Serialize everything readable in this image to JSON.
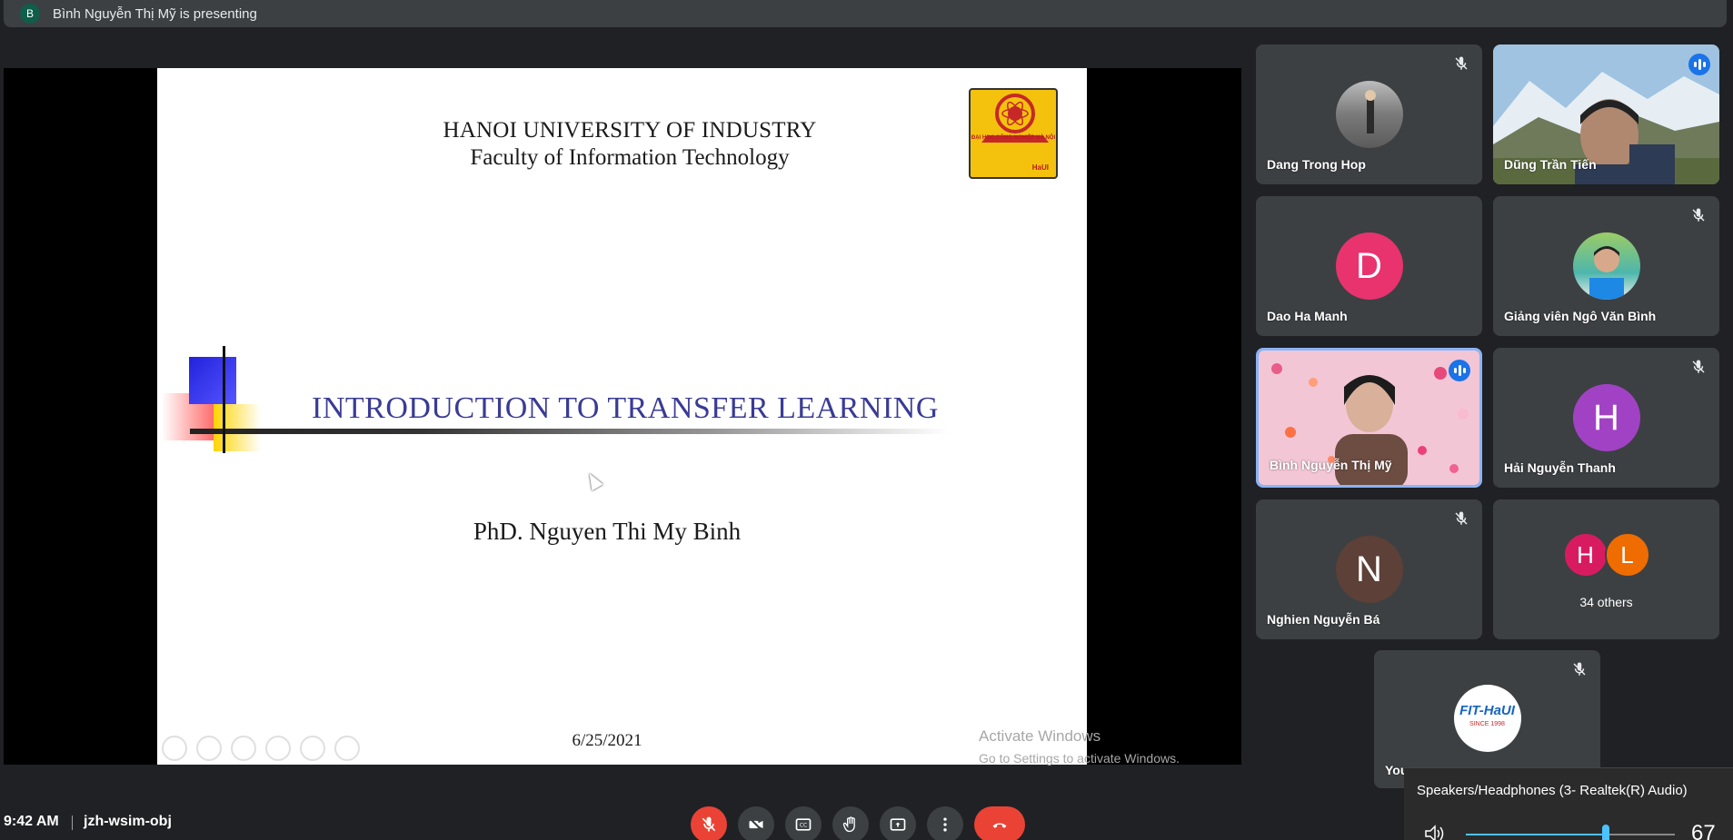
{
  "presenting": {
    "initial": "B",
    "text": "Bình Nguyễn Thị Mỹ is presenting"
  },
  "slide": {
    "university": "HANOI UNIVERSITY OF INDUSTRY",
    "faculty": "Faculty of Information Technology",
    "logo_text": "ĐẠI HỌC CÔNG NGHIỆP HÀ NỘI",
    "logo_brand": "HaUI",
    "title": "INTRODUCTION TO TRANSFER LEARNING",
    "author": "PhD. Nguyen Thi My Binh",
    "date": "6/25/2021"
  },
  "watermark": {
    "line1": "Activate Windows",
    "line2": "Go to Settings to activate Windows."
  },
  "participants": [
    {
      "name": "Dang Trong Hop",
      "muted": true
    },
    {
      "name": "Dũng Trần Tiến",
      "speaking": true
    },
    {
      "name": "Dao Ha Manh",
      "initial": "D",
      "color": "#e8336e",
      "muted": true
    },
    {
      "name": "Giảng viên Ngô Văn Bình",
      "muted": true
    },
    {
      "name": "Bình Nguyễn Thị Mỹ",
      "speaking": true
    },
    {
      "name": "Hải Nguyễn Thanh",
      "initial": "H",
      "color": "#a142c4",
      "muted": true
    },
    {
      "name": "Nghien Nguyễn Bá",
      "initial": "N",
      "color": "#5d4037",
      "muted": true
    },
    {
      "name": "You",
      "logo_text": "FIT-HaUI",
      "logo_sub": "SINCE 1998",
      "muted": true
    }
  ],
  "others": {
    "label": "34 others",
    "avatars": [
      {
        "initial": "H",
        "color": "#d81b60"
      },
      {
        "initial": "L",
        "color": "#ef6c00"
      }
    ]
  },
  "bottom": {
    "time": "9:42 AM",
    "meeting_code": "jzh-wsim-obj"
  },
  "volume": {
    "device": "Speakers/Headphones (3- Realtek(R) Audio)",
    "level": 67
  }
}
